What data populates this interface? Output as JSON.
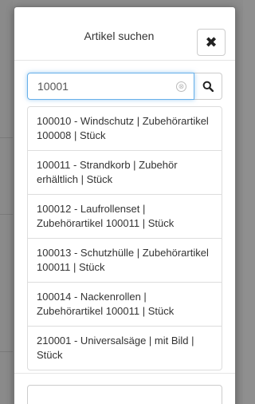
{
  "modal": {
    "title": "Artikel suchen",
    "close_icon": "close-icon",
    "close_glyph": "✖"
  },
  "search": {
    "value": "10001",
    "placeholder": "",
    "clear_icon": "clear-circle-icon",
    "clear_glyph": "⊗",
    "button_icon": "search-icon"
  },
  "results": [
    {
      "label": "100010 - Windschutz | Zubehörartikel 100008 | Stück"
    },
    {
      "label": "100011 - Strandkorb | Zubehör erhältlich | Stück"
    },
    {
      "label": "100012 - Laufrollenset | Zubehörartikel 100011 | Stück"
    },
    {
      "label": "100013 - Schutzhülle | Zubehörartikel 100011 | Stück"
    },
    {
      "label": "100014 - Nackenrollen | Zubehörartikel 100011 | Stück"
    },
    {
      "label": "210001 - Universalsäge | mit Bild | Stück"
    }
  ],
  "colors": {
    "focus_border": "#66afe9",
    "backdrop": "#8c8c8c"
  }
}
